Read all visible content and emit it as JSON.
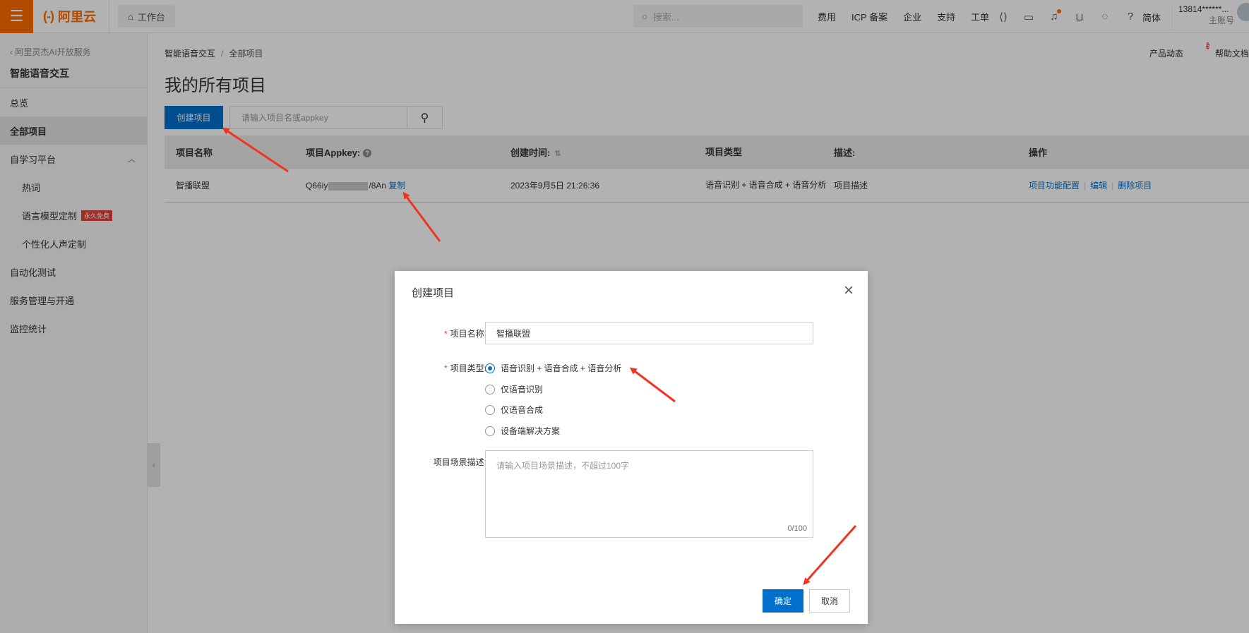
{
  "topbar": {
    "logo_text": "阿里云",
    "workbench": "工作台",
    "search_placeholder": "搜索...",
    "links": [
      "费用",
      "ICP 备案",
      "企业",
      "支持",
      "工单"
    ],
    "lang": "简体",
    "account_id": "13814******...",
    "account_role": "主账号",
    "accent_color": "#ff6a00"
  },
  "sidebar": {
    "back_link": "阿里灵杰AI开放服务",
    "title": "智能语音交互",
    "items": [
      {
        "label": "总览"
      },
      {
        "label": "全部项目"
      },
      {
        "label": "自学习平台"
      },
      {
        "label": "热词"
      },
      {
        "label": "语言模型定制",
        "badge": "永久免费"
      },
      {
        "label": "个性化人声定制"
      },
      {
        "label": "自动化测试"
      },
      {
        "label": "服务管理与开通"
      },
      {
        "label": "监控统计"
      }
    ]
  },
  "main": {
    "breadcrumb": [
      "智能语音交互",
      "全部项目"
    ],
    "product_news": "产品动态",
    "product_news_count": "5",
    "help_docs": "帮助文档",
    "page_title": "我的所有项目",
    "create_button": "创建项目",
    "search_placeholder": "请输入项目名或appkey",
    "table": {
      "headers": [
        "项目名称",
        "项目Appkey:",
        "创建时间:",
        "项目类型",
        "描述:",
        "操作"
      ],
      "rows": [
        {
          "name": "智播联盟",
          "appkey_prefix": "Q66iy",
          "appkey_suffix": "/8An",
          "copy": "复制",
          "created": "2023年9月5日 21:26:36",
          "type": "语音识别 + 语音合成 + 语音分析",
          "desc": "项目描述",
          "ops": [
            "项目功能配置",
            "编辑",
            "删除项目"
          ]
        }
      ]
    }
  },
  "dialog": {
    "title": "创建项目",
    "name_label": "项目名称:",
    "name_value": "智播联盟",
    "type_label": "项目类型:",
    "type_options": [
      "语音识别 + 语音合成 + 语音分析",
      "仅语音识别",
      "仅语音合成",
      "设备端解决方案"
    ],
    "type_selected": "语音识别 + 语音合成 + 语音分析",
    "desc_label": "项目场景描述:",
    "desc_placeholder": "请输入项目场景描述，不超过100字",
    "desc_counter": "0/100",
    "ok": "确定",
    "cancel": "取消"
  }
}
